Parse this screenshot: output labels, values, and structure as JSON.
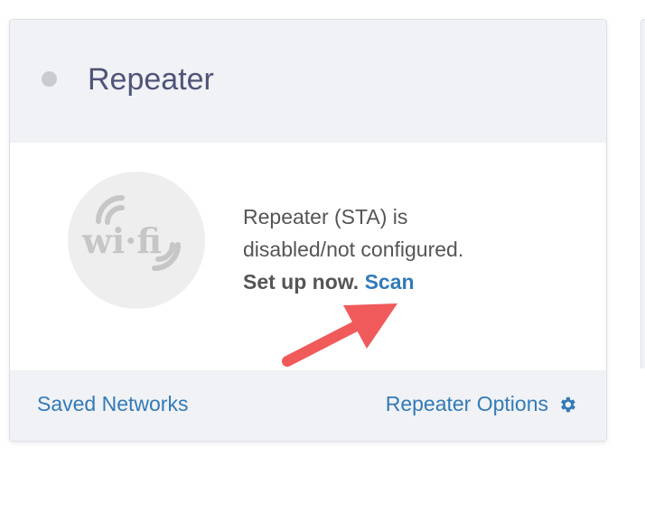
{
  "card": {
    "title": "Repeater",
    "status_indicator_color": "#c9cbce",
    "icon": "wifi-icon",
    "status_line_1": "Repeater (STA) is",
    "status_line_2": "disabled/not configured.",
    "setup_label": "Set up now.",
    "scan_label": "Scan"
  },
  "footer": {
    "saved_networks_label": "Saved Networks",
    "repeater_options_label": "Repeater Options",
    "options_icon": "gear-icon"
  },
  "annotation": {
    "icon": "red-arrow-icon",
    "color": "#f05a5a"
  },
  "colors": {
    "link": "#337ab7",
    "header_bg": "#f0f2f5",
    "title": "#4f5478"
  }
}
